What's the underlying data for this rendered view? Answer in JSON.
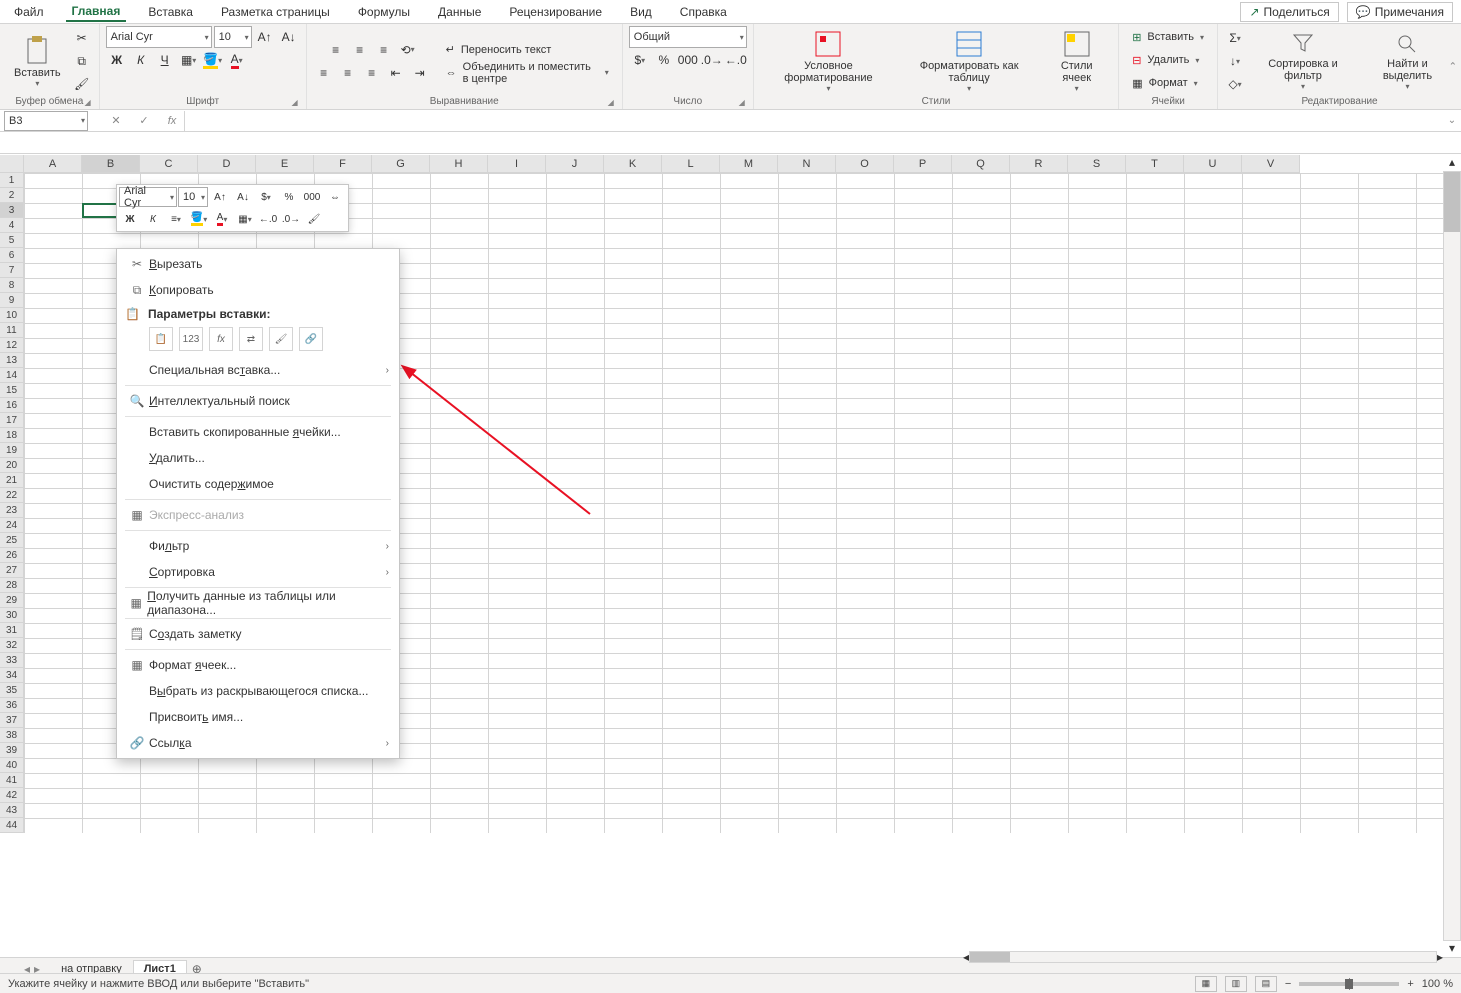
{
  "menubar": {
    "tabs": [
      "Файл",
      "Главная",
      "Вставка",
      "Разметка страницы",
      "Формулы",
      "Данные",
      "Рецензирование",
      "Вид",
      "Справка"
    ],
    "active": 1,
    "share": "Поделиться",
    "comments": "Примечания"
  },
  "ribbon": {
    "clipboard": {
      "paste": "Вставить",
      "label": "Буфер обмена"
    },
    "font": {
      "name": "Arial Cyr",
      "size": "10",
      "label": "Шрифт"
    },
    "align": {
      "wrap": "Переносить текст",
      "merge": "Объединить и поместить в центре",
      "label": "Выравнивание"
    },
    "number": {
      "format": "Общий",
      "label": "Число"
    },
    "styles": {
      "cond": "Условное форматирование",
      "table": "Форматировать как таблицу",
      "cell": "Стили ячеек",
      "label": "Стили"
    },
    "cells": {
      "insert": "Вставить",
      "delete": "Удалить",
      "format": "Формат",
      "label": "Ячейки"
    },
    "editing": {
      "sort": "Сортировка и фильтр",
      "find": "Найти и выделить",
      "label": "Редактирование"
    }
  },
  "namebox": "B3",
  "minitoolbar": {
    "font": "Arial Cyr",
    "size": "10"
  },
  "context": {
    "cut": "Вырезать",
    "copy": "Копировать",
    "paste_opts": "Параметры вставки:",
    "special": "Специальная вставка...",
    "smart": "Интеллектуальный поиск",
    "insert_copied": "Вставить скопированные ячейки...",
    "delete": "Удалить...",
    "clear": "Очистить содержимое",
    "quick": "Экспресс-анализ",
    "filter": "Фильтр",
    "sort": "Сортировка",
    "getdata": "Получить данные из таблицы или диапазона...",
    "note": "Создать заметку",
    "format_cells": "Формат ячеек...",
    "dropdown": "Выбрать из раскрывающегося списка...",
    "name": "Присвоить имя...",
    "link": "Ссылка"
  },
  "columns": [
    "A",
    "B",
    "C",
    "D",
    "E",
    "F",
    "G",
    "H",
    "I",
    "J",
    "K",
    "L",
    "M",
    "N",
    "O",
    "P",
    "Q",
    "R",
    "S",
    "T",
    "U",
    "V"
  ],
  "sheets": {
    "tabs": [
      "на отправку",
      "Лист1"
    ],
    "active": 1
  },
  "statusbar": {
    "msg": "Укажите ячейку и нажмите ВВОД или выберите \"Вставить\"",
    "zoom": "100 %"
  }
}
